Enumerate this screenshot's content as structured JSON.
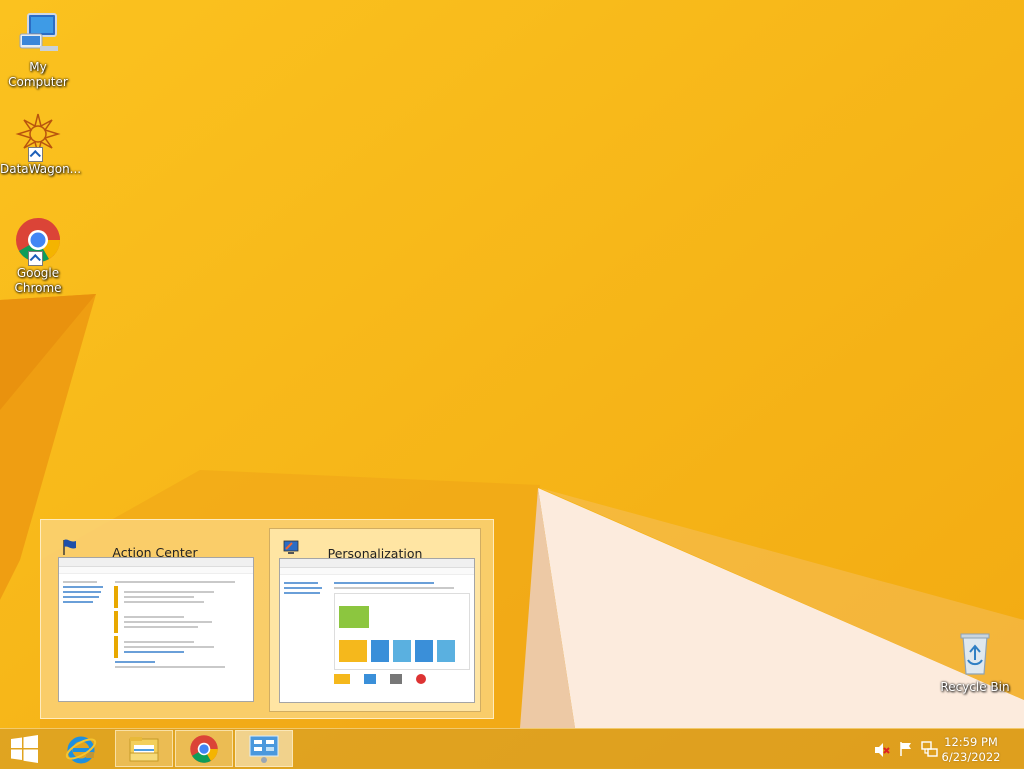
{
  "desktop": {
    "icons": [
      {
        "label": "My Computer",
        "icon": "computer-icon"
      },
      {
        "label": "DataWagon...",
        "icon": "datawagon-icon"
      },
      {
        "label": "Google Chrome",
        "icon": "chrome-icon"
      },
      {
        "label": "Recycle Bin",
        "icon": "recycle-bin-icon"
      }
    ]
  },
  "thumbnails": {
    "items": [
      {
        "title": "Action Center",
        "icon": "flag-icon"
      },
      {
        "title": "Personalization",
        "icon": "personalization-icon"
      }
    ]
  },
  "taskbar": {
    "start_icon": "windows-logo-icon",
    "pinned": [
      {
        "icon": "internet-explorer-icon"
      },
      {
        "icon": "file-explorer-icon"
      },
      {
        "icon": "chrome-icon"
      },
      {
        "icon": "control-panel-icon"
      }
    ],
    "tray": {
      "icons": [
        "speaker-muted-icon",
        "flag-icon",
        "network-icon"
      ],
      "time": "12:59 PM",
      "date": "6/23/2022"
    }
  },
  "colors": {
    "wallpaper": "#F5B81C",
    "wallpaper_light": "#FFF4E6",
    "accent": "#E8A014"
  }
}
